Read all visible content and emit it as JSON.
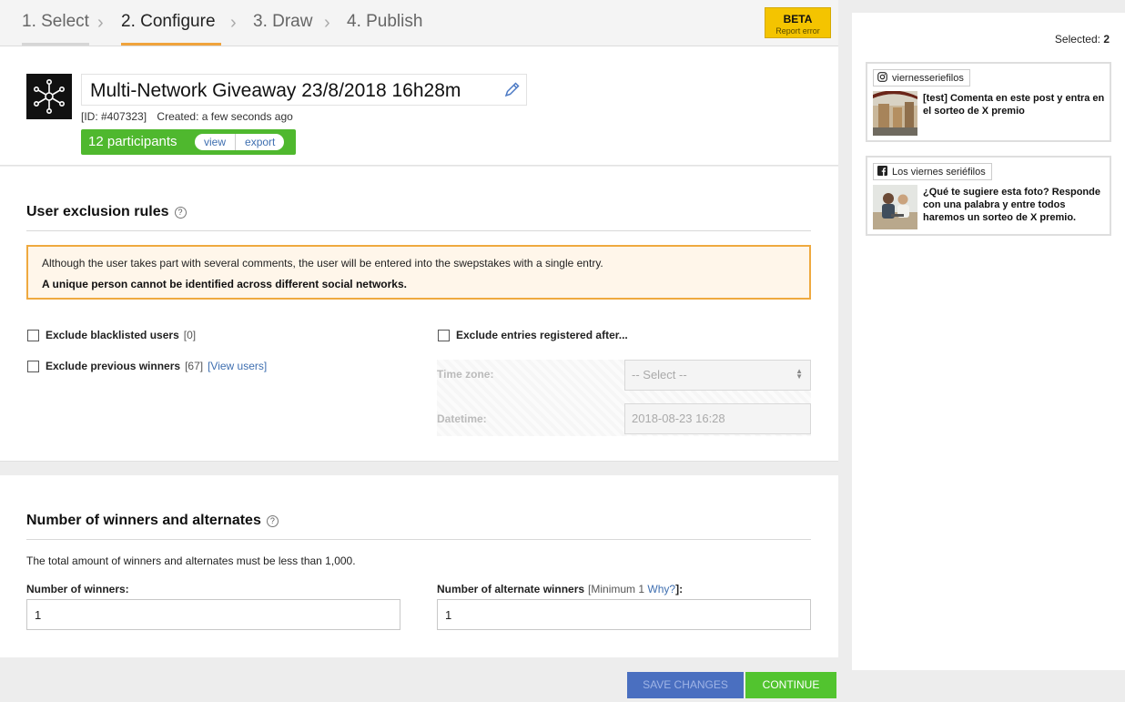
{
  "steps": [
    {
      "label": "1. Select"
    },
    {
      "label": "2. Configure"
    },
    {
      "label": "3. Draw"
    },
    {
      "label": "4. Publish"
    }
  ],
  "beta": {
    "title": "BETA",
    "subtitle": "Report error"
  },
  "giveaway": {
    "title": "Multi-Network Giveaway 23/8/2018 16h28m",
    "id": "[ID: #407323]",
    "created": "Created: a few seconds ago",
    "participants": "12 participants",
    "view_label": "view",
    "export_label": "export"
  },
  "exclusion": {
    "title": "User exclusion rules",
    "help": "?",
    "notice_line1": "Although the user takes part with several comments, the user will be entered into the swepstakes with a single entry.",
    "notice_line2": "A unique person cannot be identified across different social networks.",
    "blacklist_label": "Exclude blacklisted users",
    "blacklist_count": "[0]",
    "prev_winners_label": "Exclude previous winners",
    "prev_winners_count": "[67]",
    "view_users_link": "[View users]",
    "after_label": "Exclude entries registered after...",
    "timezone_label": "Time zone:",
    "timezone_value": "-- Select --",
    "datetime_label": "Datetime:",
    "datetime_placeholder": "2018-08-23 16:28"
  },
  "winners": {
    "title": "Number of winners and alternates",
    "help": "?",
    "note": "The total amount of winners and alternates must be less than 1,000.",
    "winners_label": "Number of winners:",
    "winners_value": "1",
    "alternates_label": "Number of alternate winners",
    "alternates_min": "[Minimum 1",
    "alternates_why": "Why?",
    "alternates_end": "]:",
    "alternates_value": "1"
  },
  "buttons": {
    "save": "SAVE CHANGES",
    "continue": "CONTINUE"
  },
  "right_panel": {
    "selected_label": "Selected:",
    "selected_count": "2",
    "cards": [
      {
        "network_icon": "instagram-icon",
        "account": "viernesseriefilos",
        "text": "[test] Comenta en este post y entra en el sorteo de X premio"
      },
      {
        "network_icon": "facebook-icon",
        "account": "Los viernes seriéfilos",
        "text": "¿Qué te sugiere esta foto? Responde con una palabra y entre todos haremos un sorteo de X premio. ¡Gracias!"
      }
    ]
  }
}
